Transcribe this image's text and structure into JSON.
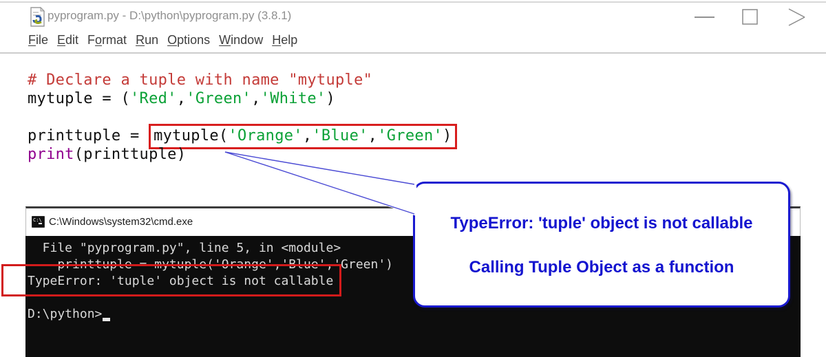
{
  "idle": {
    "title": "pyprogram.py - D:\\python\\pyprogram.py (3.8.1)",
    "menu": [
      {
        "label": "File",
        "accel": 0
      },
      {
        "label": "Edit",
        "accel": 0
      },
      {
        "label": "Format",
        "accel": 1
      },
      {
        "label": "Run",
        "accel": 0
      },
      {
        "label": "Options",
        "accel": 0
      },
      {
        "label": "Window",
        "accel": 0
      },
      {
        "label": "Help",
        "accel": 0
      }
    ],
    "code_lines": [
      [
        {
          "t": "# Declare a tuple with name \"mytuple\"",
          "c": "comment"
        }
      ],
      [
        {
          "t": "mytuple = (",
          "c": "code"
        },
        {
          "t": "'Red'",
          "c": "string"
        },
        {
          "t": ",",
          "c": "code"
        },
        {
          "t": "'Green'",
          "c": "string"
        },
        {
          "t": ",",
          "c": "code"
        },
        {
          "t": "'White'",
          "c": "string"
        },
        {
          "t": ")",
          "c": "code"
        }
      ],
      [],
      [
        {
          "t": "printtuple = ",
          "c": "code"
        },
        {
          "t": "mytuple(",
          "c": "code",
          "box": true
        },
        {
          "t": "'Orange'",
          "c": "string",
          "box": true
        },
        {
          "t": ",",
          "c": "code",
          "box": true
        },
        {
          "t": "'Blue'",
          "c": "string",
          "box": true
        },
        {
          "t": ",",
          "c": "code",
          "box": true
        },
        {
          "t": "'Green'",
          "c": "string",
          "box": true
        },
        {
          "t": ")",
          "c": "code",
          "box": true
        }
      ],
      [
        {
          "t": "print",
          "c": "builtin"
        },
        {
          "t": "(printtuple)",
          "c": "code"
        }
      ]
    ]
  },
  "cmd": {
    "title": "C:\\Windows\\system32\\cmd.exe",
    "lines": [
      "  File \"pyprogram.py\", line 5, in <module>",
      "    printtuple = mytuple('Orange','Blue','Green')",
      "TypeError: 'tuple' object is not callable",
      ""
    ],
    "prompt": "D:\\python>"
  },
  "callout": {
    "line1": "TypeError: 'tuple' object is not callable",
    "line2": "Calling Tuple Object as a function"
  },
  "colors": {
    "comment_red": "#c43b38",
    "string_green": "#0ba136",
    "builtin_purple": "#90008e",
    "highlight_red": "#d81e1e",
    "callout_blue": "#1414cf",
    "console_bg": "#0d0d0d",
    "console_text": "#d9d9d9"
  }
}
